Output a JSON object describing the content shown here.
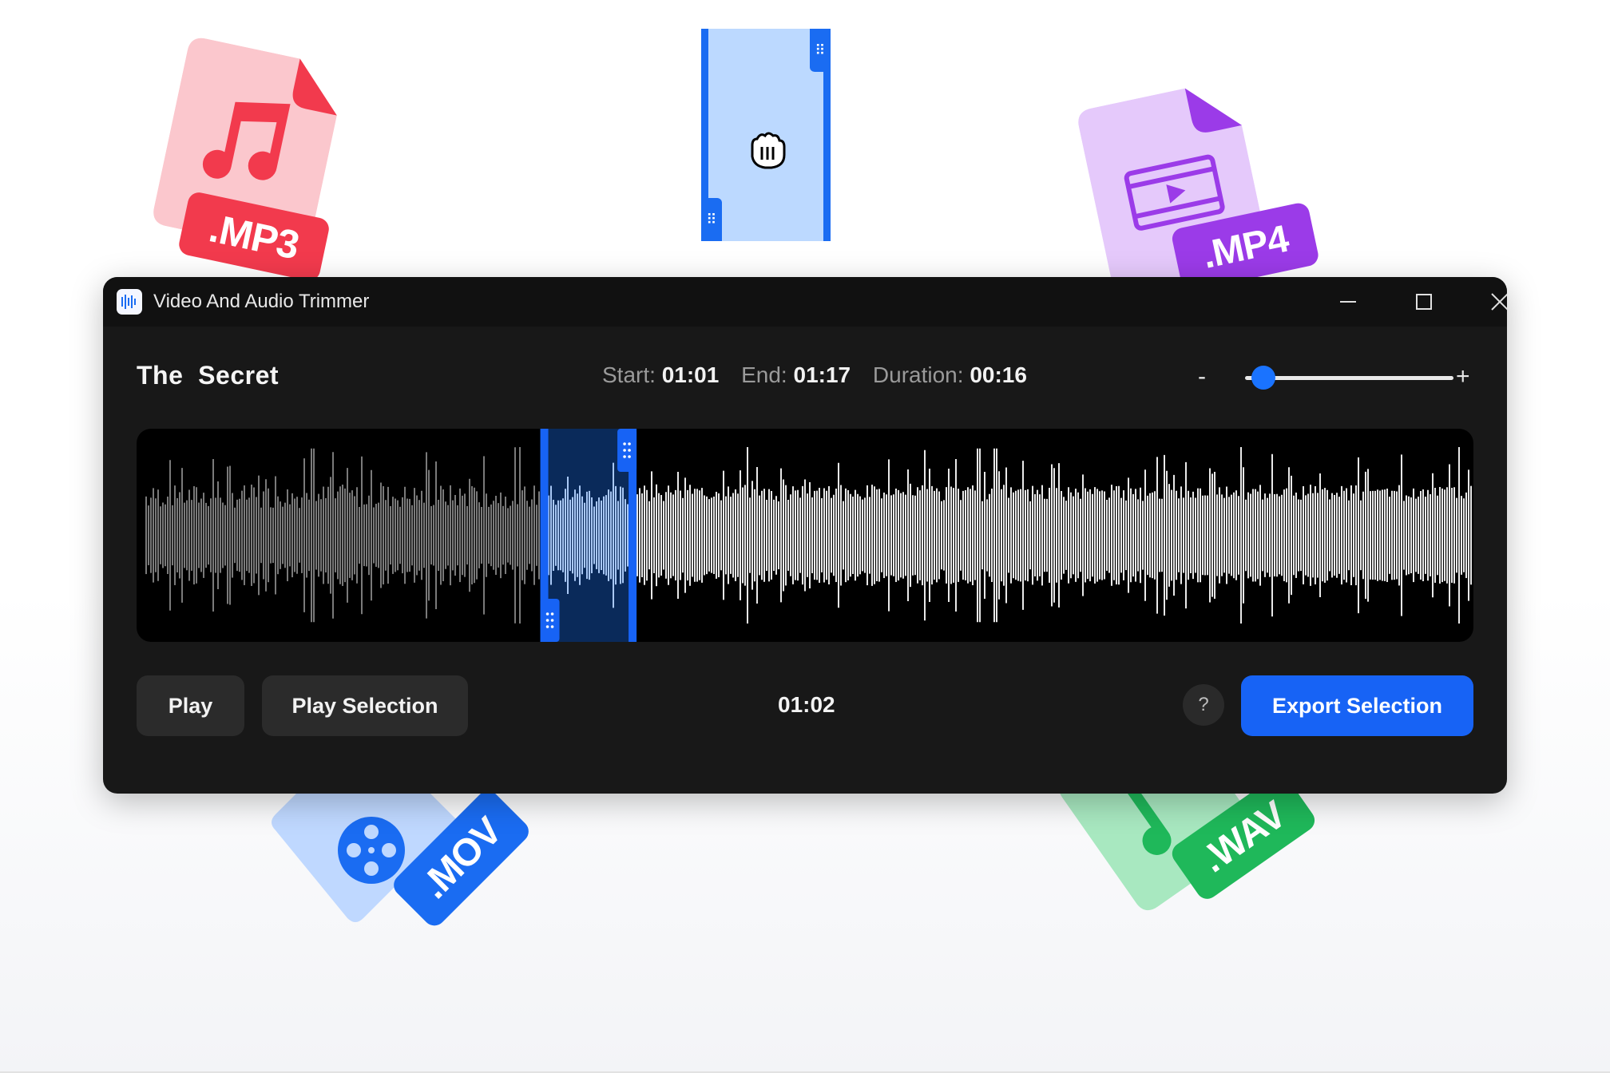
{
  "window": {
    "title": "Video And Audio Trimmer",
    "controls": {
      "minimize": "minimize-icon",
      "maximize": "maximize-icon",
      "close": "close-icon"
    }
  },
  "track": {
    "title": "The  Secret",
    "start_label": "Start:",
    "start_value": "01:01",
    "end_label": "End:",
    "end_value": "01:17",
    "duration_label": "Duration:",
    "duration_value": "00:16"
  },
  "zoom": {
    "minus": "-",
    "plus": "+",
    "level": 0.05
  },
  "selection": {
    "start_fraction": 0.302,
    "end_fraction": 0.374
  },
  "buttons": {
    "play": "Play",
    "play_selection": "Play Selection",
    "help": "?",
    "export": "Export Selection"
  },
  "current_time": "01:02",
  "file_badges": {
    "mp3": ".MP3",
    "mp4": ".MP4",
    "mov": ".MOV",
    "wav": ".WAV"
  },
  "colors": {
    "accent": "#1763f5",
    "selection_bg": "#0a2a5a",
    "mp3": "#f23a4d",
    "mp4": "#9b3be8",
    "mov": "#1a6cf2",
    "wav": "#1fb85a"
  }
}
